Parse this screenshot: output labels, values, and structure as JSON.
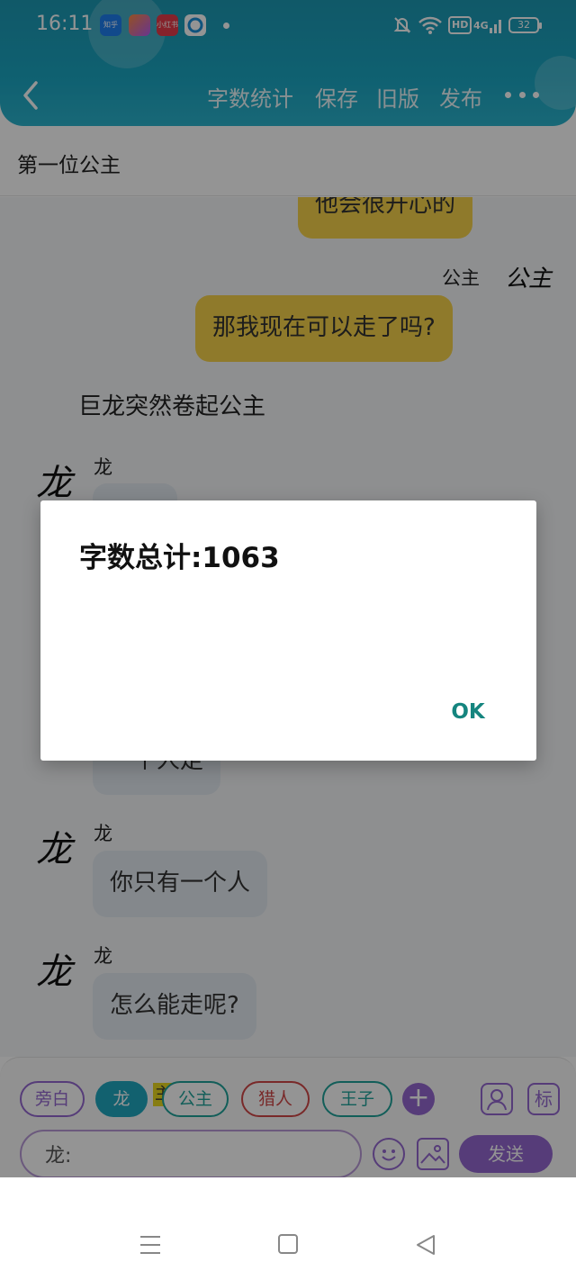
{
  "status_bar": {
    "time": "16:11",
    "apps": [
      "知乎",
      "",
      "小红书",
      ""
    ],
    "hd": "HD",
    "network": "4G",
    "battery": "32"
  },
  "toolbar": {
    "items": [
      "字数统计",
      "保存",
      "旧版",
      "发布"
    ],
    "more_icon": "more-horizontal-icon",
    "back_icon": "chevron-left-icon"
  },
  "chapter": {
    "title": "第一位公主"
  },
  "chat": {
    "messages": [
      {
        "speaker": "",
        "text": "他会很开心的",
        "side": "right"
      },
      {
        "speaker": "公主",
        "avatar": "公主",
        "text": "那我现在可以走了吗?",
        "side": "right"
      },
      {
        "narration": "巨龙突然卷起公主"
      },
      {
        "speaker": "龙",
        "avatar": "龙",
        "text": "",
        "side": "left"
      },
      {
        "speaker": "",
        "avatar": "",
        "text": "一个人走",
        "side": "left"
      },
      {
        "speaker": "龙",
        "avatar": "龙",
        "text": "你只有一个人",
        "side": "left"
      },
      {
        "speaker": "龙",
        "avatar": "龙",
        "text": "怎么能走呢?",
        "side": "left"
      }
    ]
  },
  "roles": [
    {
      "label": "旁白",
      "color": "#9468d0"
    },
    {
      "label": "龙",
      "color": "#20a7bf",
      "selected": true
    },
    {
      "label": "公主",
      "color": "#1fa39a",
      "badge": "主"
    },
    {
      "label": "猎人",
      "color": "#d04848"
    },
    {
      "label": "王子",
      "color": "#1fa39a"
    }
  ],
  "composer": {
    "input_value": "龙:",
    "send_label": "发送",
    "tag_label": "标",
    "accent": "#9468d0"
  },
  "dialog": {
    "title": "字数总计:1063",
    "ok_label": "OK"
  }
}
